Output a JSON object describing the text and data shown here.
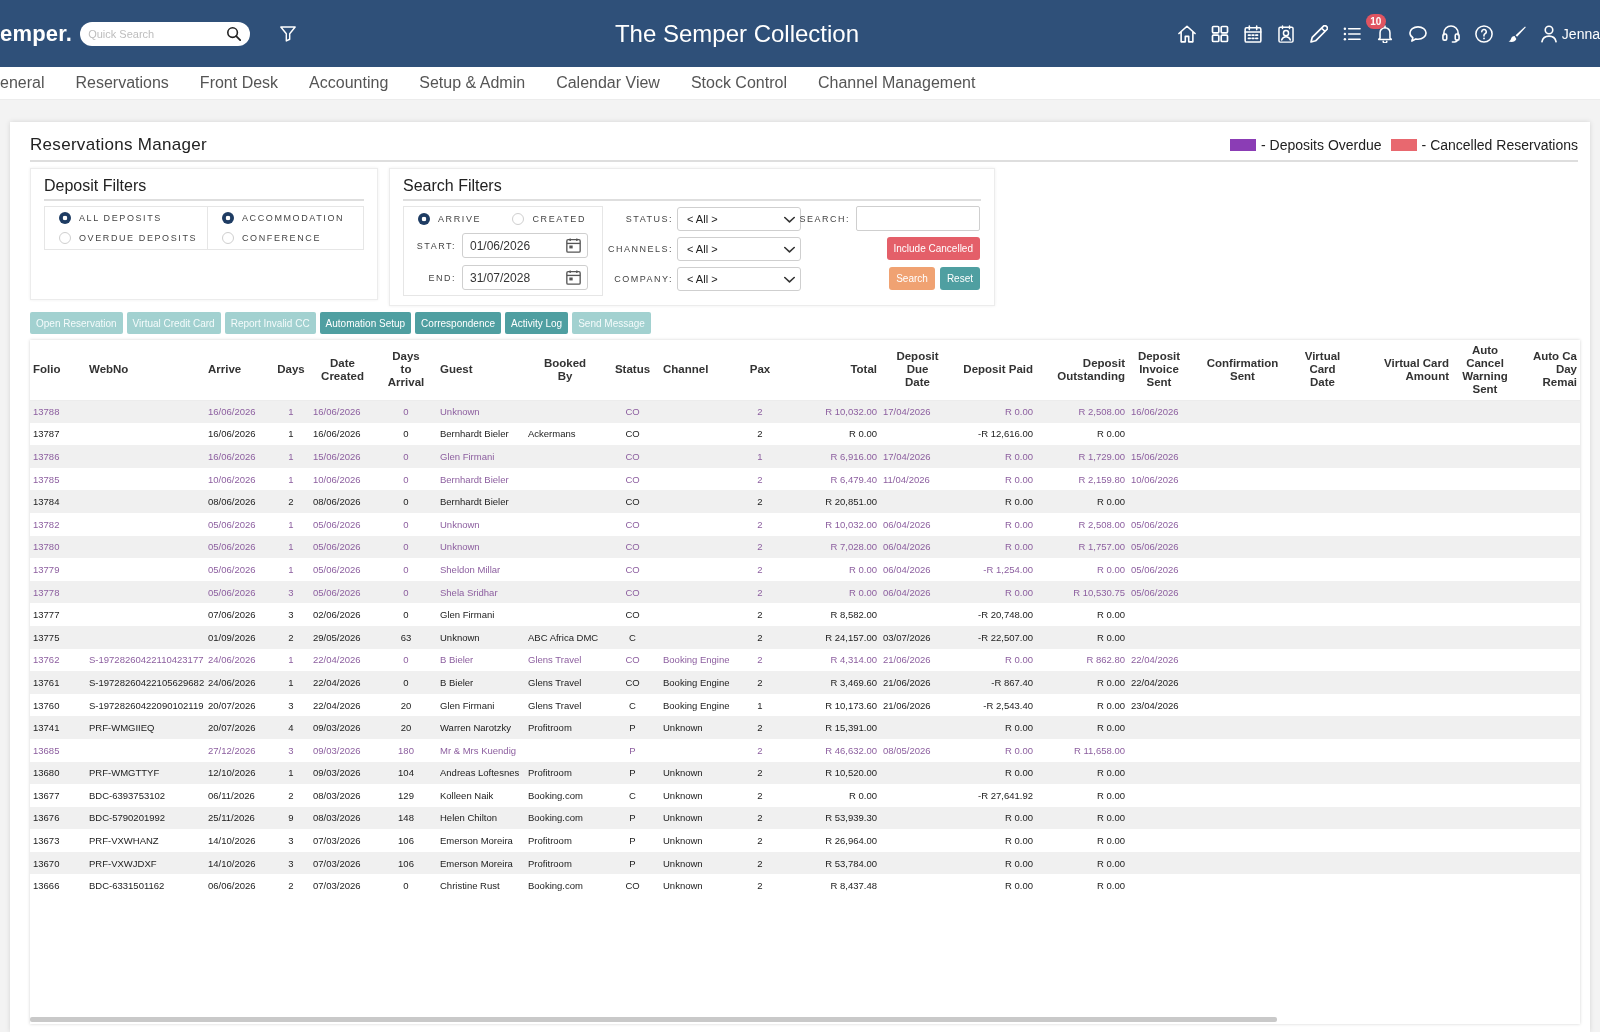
{
  "header": {
    "logo": "emper.",
    "quick_search": {
      "placeholder": "Quick Search"
    },
    "title": "The Semper Collection",
    "notifications": "10",
    "user": "Jenna"
  },
  "nav": [
    "eneral",
    "Reservations",
    "Front Desk",
    "Accounting",
    "Setup & Admin",
    "Calendar View",
    "Stock Control",
    "Channel Management"
  ],
  "page_title": "Reservations Manager",
  "legend": [
    {
      "label": "- Deposits Overdue",
      "color": "#8b3db5"
    },
    {
      "label": "- Cancelled Reservations",
      "color": "#e8686f"
    }
  ],
  "deposit_filters": {
    "title": "Deposit Filters",
    "groups": [
      {
        "options": [
          {
            "label": "ALL DEPOSITS",
            "selected": true
          },
          {
            "label": "OVERDUE DEPOSITS",
            "selected": false
          }
        ]
      },
      {
        "options": [
          {
            "label": "ACCOMMODATION",
            "selected": true
          },
          {
            "label": "CONFERENCE",
            "selected": false
          }
        ]
      }
    ]
  },
  "search_filters": {
    "title": "Search Filters",
    "date_type": [
      {
        "label": "ARRIVE",
        "selected": true
      },
      {
        "label": "CREATED",
        "selected": false
      }
    ],
    "dates": [
      {
        "label": "START:",
        "value": "01/06/2026"
      },
      {
        "label": "END:",
        "value": "31/07/2028"
      }
    ],
    "selects": [
      {
        "label": "STATUS:",
        "value": "< All >"
      },
      {
        "label": "CHANNELS:",
        "value": "< All >"
      },
      {
        "label": "COMPANY:",
        "value": "< All >"
      }
    ],
    "search": {
      "label": "SEARCH:"
    },
    "include_cancelled": {
      "label": "Include Cancelled"
    },
    "buttons": [
      {
        "label": "Search",
        "kind": "warning"
      },
      {
        "label": "Reset",
        "kind": "primary"
      }
    ]
  },
  "actions": [
    {
      "label": "Open Reservation",
      "disabled": true
    },
    {
      "label": "Virtual Credit Card",
      "disabled": true
    },
    {
      "label": "Report Invalid CC",
      "disabled": true
    },
    {
      "label": "Automation Setup",
      "disabled": false
    },
    {
      "label": "Correspondence",
      "disabled": false
    },
    {
      "label": "Activity Log",
      "disabled": false
    },
    {
      "label": "Send Message",
      "disabled": true
    }
  ],
  "table": {
    "columns": [
      "Folio",
      "WebNo",
      "Arrive",
      "Days",
      "Date Created",
      "Days to Arrival",
      "Guest",
      "Booked By",
      "Status",
      "Channel",
      "Pax",
      "Total",
      "Deposit Due Date",
      "Deposit Paid",
      "Deposit Outstanding",
      "Deposit Invoice Sent",
      "Confirmation Sent",
      "Virtual Card Date",
      "Virtual Card Amount",
      "Auto Cancel Warning Sent",
      "Auto Ca Day Remai"
    ],
    "rows": [
      {
        "overdue": true,
        "folio": "13788",
        "arrive": "16/06/2026",
        "days": "1",
        "date_created": "16/06/2026",
        "days_to_arrival": "0",
        "guest": "Unknown",
        "status": "CO",
        "pax": "2",
        "total": "R 10,032.00",
        "deposit_due_date": "17/04/2026",
        "deposit_paid": "R 0.00",
        "deposit_outstanding": "R 2,508.00",
        "deposit_invoice_sent": "16/06/2026"
      },
      {
        "overdue": false,
        "folio": "13787",
        "arrive": "16/06/2026",
        "days": "1",
        "date_created": "16/06/2026",
        "days_to_arrival": "0",
        "guest": "Bernhardt Bieler",
        "booked_by": "Ackermans",
        "status": "CO",
        "pax": "2",
        "total": "R 0.00",
        "deposit_paid": "-R 12,616.00",
        "deposit_outstanding": "R 0.00"
      },
      {
        "overdue": true,
        "folio": "13786",
        "arrive": "16/06/2026",
        "days": "1",
        "date_created": "15/06/2026",
        "days_to_arrival": "0",
        "guest": "Glen Firmani",
        "status": "CO",
        "pax": "1",
        "total": "R 6,916.00",
        "deposit_due_date": "17/04/2026",
        "deposit_paid": "R 0.00",
        "deposit_outstanding": "R 1,729.00",
        "deposit_invoice_sent": "15/06/2026"
      },
      {
        "overdue": true,
        "folio": "13785",
        "arrive": "10/06/2026",
        "days": "1",
        "date_created": "10/06/2026",
        "days_to_arrival": "0",
        "guest": "Bernhardt Bieler",
        "status": "CO",
        "pax": "2",
        "total": "R 6,479.40",
        "deposit_due_date": "11/04/2026",
        "deposit_paid": "R 0.00",
        "deposit_outstanding": "R 2,159.80",
        "deposit_invoice_sent": "10/06/2026"
      },
      {
        "overdue": false,
        "folio": "13784",
        "arrive": "08/06/2026",
        "days": "2",
        "date_created": "08/06/2026",
        "days_to_arrival": "0",
        "guest": "Bernhardt Bieler",
        "status": "CO",
        "pax": "2",
        "total": "R 20,851.00",
        "deposit_paid": "R 0.00",
        "deposit_outstanding": "R 0.00"
      },
      {
        "overdue": true,
        "folio": "13782",
        "arrive": "05/06/2026",
        "days": "1",
        "date_created": "05/06/2026",
        "days_to_arrival": "0",
        "guest": "Unknown",
        "status": "CO",
        "pax": "2",
        "total": "R 10,032.00",
        "deposit_due_date": "06/04/2026",
        "deposit_paid": "R 0.00",
        "deposit_outstanding": "R 2,508.00",
        "deposit_invoice_sent": "05/06/2026"
      },
      {
        "overdue": true,
        "folio": "13780",
        "arrive": "05/06/2026",
        "days": "1",
        "date_created": "05/06/2026",
        "days_to_arrival": "0",
        "guest": "Unknown",
        "status": "CO",
        "pax": "2",
        "total": "R 7,028.00",
        "deposit_due_date": "06/04/2026",
        "deposit_paid": "R 0.00",
        "deposit_outstanding": "R 1,757.00",
        "deposit_invoice_sent": "05/06/2026"
      },
      {
        "overdue": true,
        "folio": "13779",
        "arrive": "05/06/2026",
        "days": "1",
        "date_created": "05/06/2026",
        "days_to_arrival": "0",
        "guest": "Sheldon Millar",
        "status": "CO",
        "pax": "2",
        "total": "R 0.00",
        "deposit_due_date": "06/04/2026",
        "deposit_paid": "-R 1,254.00",
        "deposit_outstanding": "R 0.00",
        "deposit_invoice_sent": "05/06/2026"
      },
      {
        "overdue": true,
        "folio": "13778",
        "arrive": "05/06/2026",
        "days": "3",
        "date_created": "05/06/2026",
        "days_to_arrival": "0",
        "guest": "Shela Sridhar",
        "status": "CO",
        "pax": "2",
        "total": "R 0.00",
        "deposit_due_date": "06/04/2026",
        "deposit_paid": "R 0.00",
        "deposit_outstanding": "R 10,530.75",
        "deposit_invoice_sent": "05/06/2026"
      },
      {
        "overdue": false,
        "folio": "13777",
        "arrive": "07/06/2026",
        "days": "3",
        "date_created": "02/06/2026",
        "days_to_arrival": "0",
        "guest": "Glen Firmani",
        "status": "CO",
        "pax": "2",
        "total": "R 8,582.00",
        "deposit_paid": "-R 20,748.00",
        "deposit_outstanding": "R 0.00"
      },
      {
        "overdue": false,
        "folio": "13775",
        "arrive": "01/09/2026",
        "days": "2",
        "date_created": "29/05/2026",
        "days_to_arrival": "63",
        "guest": "Unknown",
        "booked_by": "ABC Africa DMC",
        "status": "C",
        "pax": "2",
        "total": "R 24,157.00",
        "deposit_due_date": "03/07/2026",
        "deposit_paid": "-R 22,507.00",
        "deposit_outstanding": "R 0.00"
      },
      {
        "overdue": true,
        "folio": "13762",
        "web_no": "S-19728260422110423177",
        "arrive": "24/06/2026",
        "days": "1",
        "date_created": "22/04/2026",
        "days_to_arrival": "0",
        "guest": "B Bieler",
        "booked_by": "Glens Travel",
        "status": "CO",
        "channel": "Booking Engine",
        "pax": "2",
        "total": "R 4,314.00",
        "deposit_due_date": "21/06/2026",
        "deposit_paid": "R 0.00",
        "deposit_outstanding": "R 862.80",
        "deposit_invoice_sent": "22/04/2026"
      },
      {
        "overdue": false,
        "folio": "13761",
        "web_no": "S-19728260422105629682",
        "arrive": "24/06/2026",
        "days": "1",
        "date_created": "22/04/2026",
        "days_to_arrival": "0",
        "guest": "B Bieler",
        "booked_by": "Glens Travel",
        "status": "CO",
        "channel": "Booking Engine",
        "pax": "2",
        "total": "R 3,469.60",
        "deposit_due_date": "21/06/2026",
        "deposit_paid": "-R 867.40",
        "deposit_outstanding": "R 0.00",
        "deposit_invoice_sent": "22/04/2026"
      },
      {
        "overdue": false,
        "folio": "13760",
        "web_no": "S-19728260422090102119",
        "arrive": "20/07/2026",
        "days": "3",
        "date_created": "22/04/2026",
        "days_to_arrival": "20",
        "guest": "Glen Firmani",
        "booked_by": "Glens Travel",
        "status": "C",
        "channel": "Booking Engine",
        "pax": "1",
        "total": "R 10,173.60",
        "deposit_due_date": "21/06/2026",
        "deposit_paid": "-R 2,543.40",
        "deposit_outstanding": "R 0.00",
        "deposit_invoice_sent": "23/04/2026"
      },
      {
        "overdue": false,
        "folio": "13741",
        "web_no": "PRF-WMGIIEQ",
        "arrive": "20/07/2026",
        "days": "4",
        "date_created": "09/03/2026",
        "days_to_arrival": "20",
        "guest": "Warren Narotzky",
        "booked_by": "Profitroom",
        "status": "P",
        "channel": "Unknown",
        "pax": "2",
        "total": "R 15,391.00",
        "deposit_paid": "R 0.00",
        "deposit_outstanding": "R 0.00"
      },
      {
        "overdue": true,
        "folio": "13685",
        "arrive": "27/12/2026",
        "days": "3",
        "date_created": "09/03/2026",
        "days_to_arrival": "180",
        "guest": "Mr & Mrs Kuendig",
        "status": "P",
        "pax": "2",
        "total": "R 46,632.00",
        "deposit_due_date": "08/05/2026",
        "deposit_paid": "R 0.00",
        "deposit_outstanding": "R 11,658.00"
      },
      {
        "overdue": false,
        "folio": "13680",
        "web_no": "PRF-WMGTTYF",
        "arrive": "12/10/2026",
        "days": "1",
        "date_created": "09/03/2026",
        "days_to_arrival": "104",
        "guest": "Andreas Loftesnes",
        "booked_by": "Profitroom",
        "status": "P",
        "channel": "Unknown",
        "pax": "2",
        "total": "R 10,520.00",
        "deposit_paid": "R 0.00",
        "deposit_outstanding": "R 0.00"
      },
      {
        "overdue": false,
        "folio": "13677",
        "web_no": "BDC-6393753102",
        "arrive": "06/11/2026",
        "days": "2",
        "date_created": "08/03/2026",
        "days_to_arrival": "129",
        "guest": "Kolleen Naik",
        "booked_by": "Booking.com",
        "status": "C",
        "channel": "Unknown",
        "pax": "2",
        "total": "R 0.00",
        "deposit_paid": "-R 27,641.92",
        "deposit_outstanding": "R 0.00"
      },
      {
        "overdue": false,
        "folio": "13676",
        "web_no": "BDC-5790201992",
        "arrive": "25/11/2026",
        "days": "9",
        "date_created": "08/03/2026",
        "days_to_arrival": "148",
        "guest": "Helen Chilton",
        "booked_by": "Booking.com",
        "status": "P",
        "channel": "Unknown",
        "pax": "2",
        "total": "R 53,939.30",
        "deposit_paid": "R 0.00",
        "deposit_outstanding": "R 0.00"
      },
      {
        "overdue": false,
        "folio": "13673",
        "web_no": "PRF-VXWHANZ",
        "arrive": "14/10/2026",
        "days": "3",
        "date_created": "07/03/2026",
        "days_to_arrival": "106",
        "guest": "Emerson Moreira",
        "booked_by": "Profitroom",
        "status": "P",
        "channel": "Unknown",
        "pax": "2",
        "total": "R 26,964.00",
        "deposit_paid": "R 0.00",
        "deposit_outstanding": "R 0.00"
      },
      {
        "overdue": false,
        "folio": "13670",
        "web_no": "PRF-VXWJDXF",
        "arrive": "14/10/2026",
        "days": "3",
        "date_created": "07/03/2026",
        "days_to_arrival": "106",
        "guest": "Emerson Moreira",
        "booked_by": "Profitroom",
        "status": "P",
        "channel": "Unknown",
        "pax": "2",
        "total": "R 53,784.00",
        "deposit_paid": "R 0.00",
        "deposit_outstanding": "R 0.00"
      },
      {
        "overdue": false,
        "folio": "13666",
        "web_no": "BDC-6331501162",
        "arrive": "06/06/2026",
        "days": "2",
        "date_created": "07/03/2026",
        "days_to_arrival": "0",
        "guest": "Christine Rust",
        "booked_by": "Booking.com",
        "status": "CO",
        "channel": "Unknown",
        "pax": "2",
        "total": "R 8,437.48",
        "deposit_paid": "R 0.00",
        "deposit_outstanding": "R 0.00"
      }
    ]
  }
}
